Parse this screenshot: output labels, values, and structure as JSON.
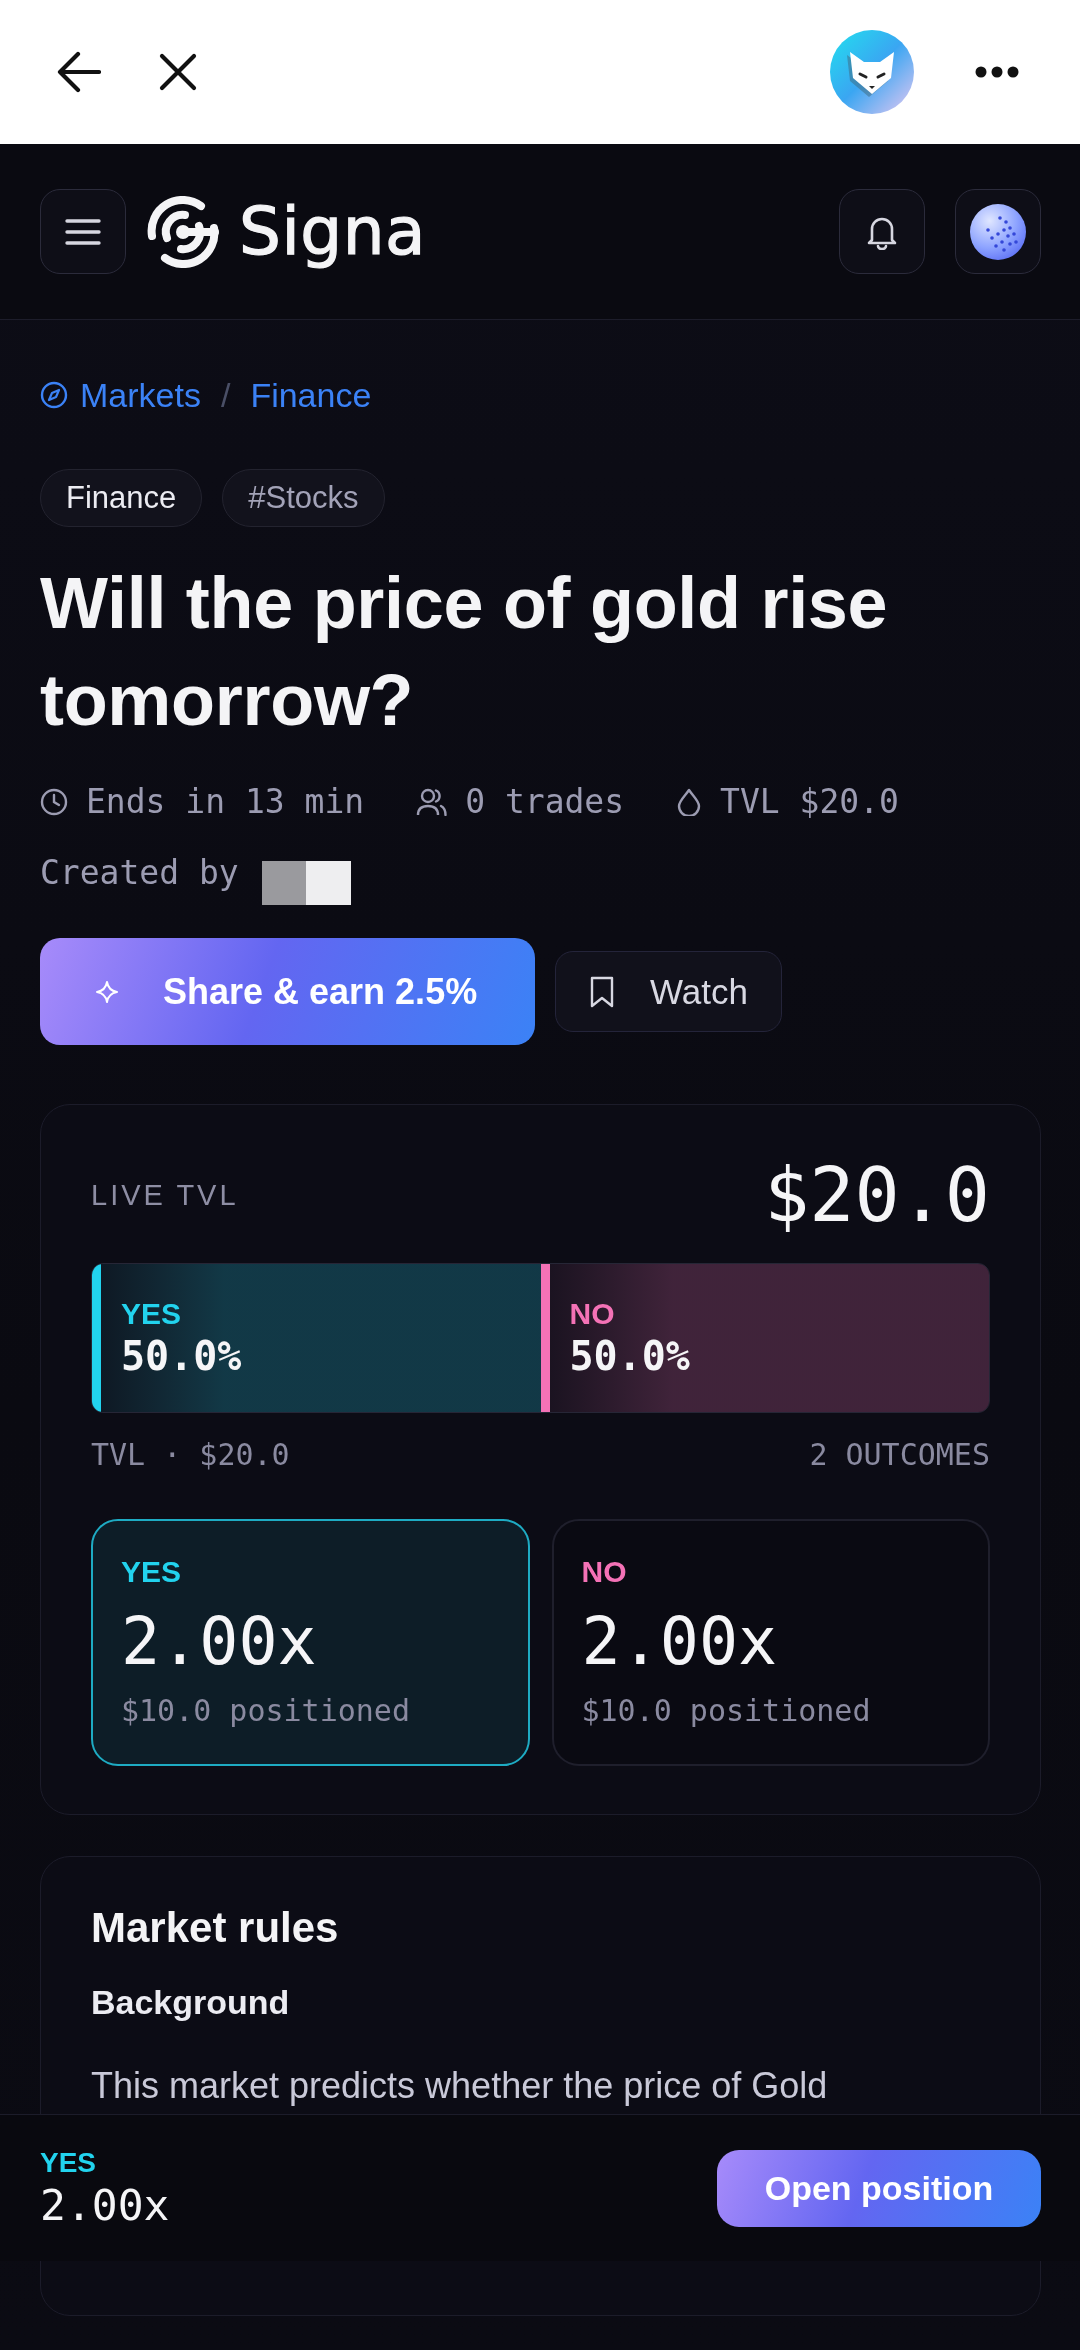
{
  "header": {
    "brand": "Signa"
  },
  "breadcrumb": {
    "items": [
      "Markets",
      "Finance"
    ],
    "separator": "/"
  },
  "tags": [
    {
      "label": "Finance",
      "kind": "category"
    },
    {
      "label": "#Stocks",
      "kind": "hashtag"
    }
  ],
  "title": "Will the price of gold rise tomorrow?",
  "meta": [
    {
      "kind": "deadline",
      "text": "Ends in 13 min"
    },
    {
      "kind": "trades",
      "text": "0 trades"
    },
    {
      "kind": "tvl",
      "text": "TVL $20.0"
    }
  ],
  "creator": {
    "label": "Created by"
  },
  "actions": {
    "share": "Share & earn 2.5%",
    "watch": {
      "label": "Watch",
      "watching": false
    }
  },
  "tvl_card": {
    "label": "LIVE TVL",
    "value": "$20.0",
    "split": [
      {
        "name": "YES",
        "percent": "50.0%",
        "level": 0.5,
        "color": "#22d3ee"
      },
      {
        "name": "NO",
        "percent": "50.0%",
        "level": 0.5,
        "color": "#f472b6"
      }
    ],
    "footer_left": "TVL · $20.0",
    "footer_right": "2 OUTCOMES",
    "outcomes": [
      {
        "name": "YES",
        "multiplier": "2.00x",
        "positioned": "$10.0 positioned",
        "selected": true,
        "color": "#22d3ee"
      },
      {
        "name": "NO",
        "multiplier": "2.00x",
        "positioned": "$10.0 positioned",
        "selected": false,
        "color": "#f472b6"
      }
    ]
  },
  "rules": {
    "title": "Market rules",
    "heading": "Background",
    "text": "This market predicts whether the price of Gold"
  },
  "bottom_bar": {
    "outcome": "YES",
    "multiplier": "2.00x",
    "button": "Open position"
  }
}
